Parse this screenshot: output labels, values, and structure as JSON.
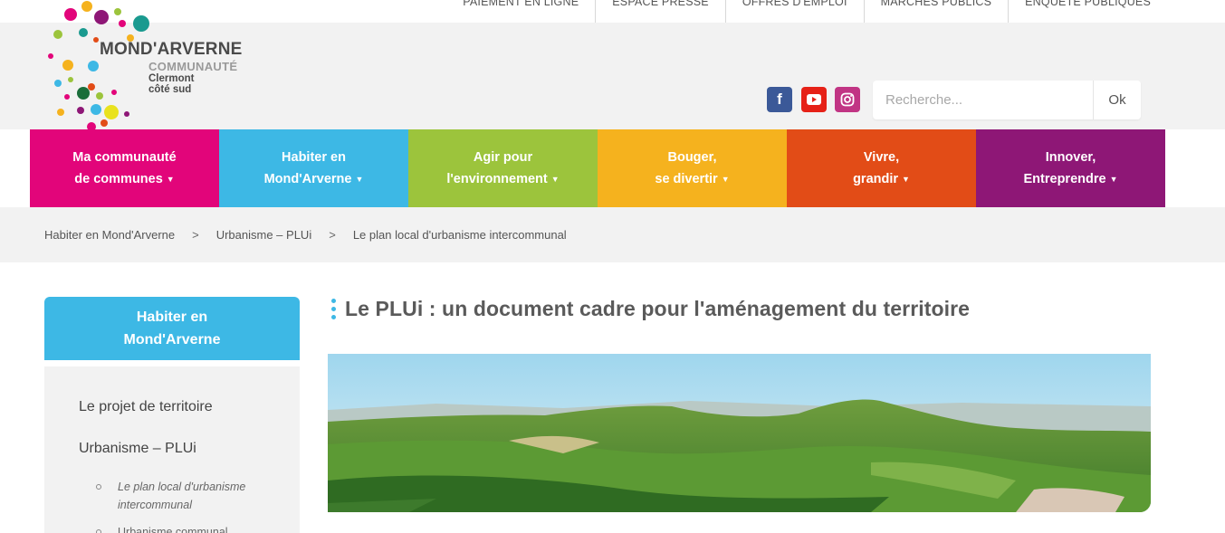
{
  "top_links": [
    "PAIEMENT EN LIGNE",
    "ESPACE PRESSE",
    "OFFRES D'EMPLOI",
    "MARCHÉS PUBLICS",
    "ENQUÊTE PUBLIQUES"
  ],
  "logo": {
    "title": "MOND'ARVERNE",
    "subtitle": "COMMUNAUTÉ",
    "tagline": "Clermont côté sud"
  },
  "social": {
    "facebook": "facebook-icon",
    "youtube": "youtube-icon",
    "instagram": "instagram-icon"
  },
  "search": {
    "placeholder": "Recherche...",
    "button": "Ok"
  },
  "nav": [
    {
      "line1": "Ma communauté",
      "line2": "de communes",
      "color": "#e2057a"
    },
    {
      "line1": "Habiter en",
      "line2": "Mond'Arverne",
      "color": "#3db8e5"
    },
    {
      "line1": "Agir pour",
      "line2": "l'environnement",
      "color": "#9cc43c"
    },
    {
      "line1": "Bouger,",
      "line2": "se divertir",
      "color": "#f5b21e"
    },
    {
      "line1": "Vivre,",
      "line2": "grandir",
      "color": "#e24c17"
    },
    {
      "line1": "Innover,",
      "line2": "Entreprendre",
      "color": "#8e1776"
    }
  ],
  "breadcrumb": [
    "Habiter en Mond'Arverne",
    "Urbanisme – PLUi",
    "Le plan local d'urbanisme intercommunal"
  ],
  "breadcrumb_sep": ">",
  "sidebar": {
    "heading_line1": "Habiter en",
    "heading_line2": "Mond'Arverne",
    "items": [
      "Le projet de territoire",
      "Urbanisme – PLUi"
    ],
    "subitems": [
      {
        "line1": "Le plan local d'urbanisme",
        "line2": "intercommunal"
      },
      {
        "line1": "Urbanisme communal",
        "line2": ""
      }
    ]
  },
  "main": {
    "title": "Le PLUi : un document cadre pour l'aménagement du territoire",
    "hero_image": "landscape-volcano-image"
  },
  "colors": {
    "accent_blue": "#3db8e5",
    "header_bg": "#f2f2f2"
  }
}
